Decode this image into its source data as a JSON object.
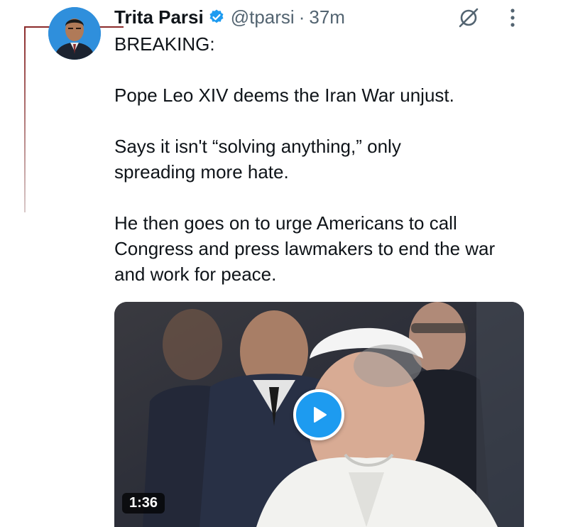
{
  "author": {
    "display_name": "Trita Parsi",
    "handle": "@tparsi",
    "separator": "·",
    "time": "37m",
    "verified": true,
    "avatar_icon": "profile-avatar"
  },
  "tweet": {
    "lines": [
      "BREAKING:",
      "Pope Leo XIV deems the Iran War unjust.",
      "Says it isn't “solving anything,” only spreading more hate.",
      "He then goes on to urge Americans to call Congress and press lawmakers to end the war and work for peace."
    ]
  },
  "media": {
    "type": "video",
    "duration": "1:36",
    "play_icon": "play-icon"
  },
  "actions": {
    "grok_icon": "grok-icon",
    "more_icon": "more-options-icon"
  },
  "colors": {
    "accent": "#1d9bf0",
    "text_primary": "#0f1419",
    "text_secondary": "#536471",
    "verified": "#1d9bf0"
  }
}
